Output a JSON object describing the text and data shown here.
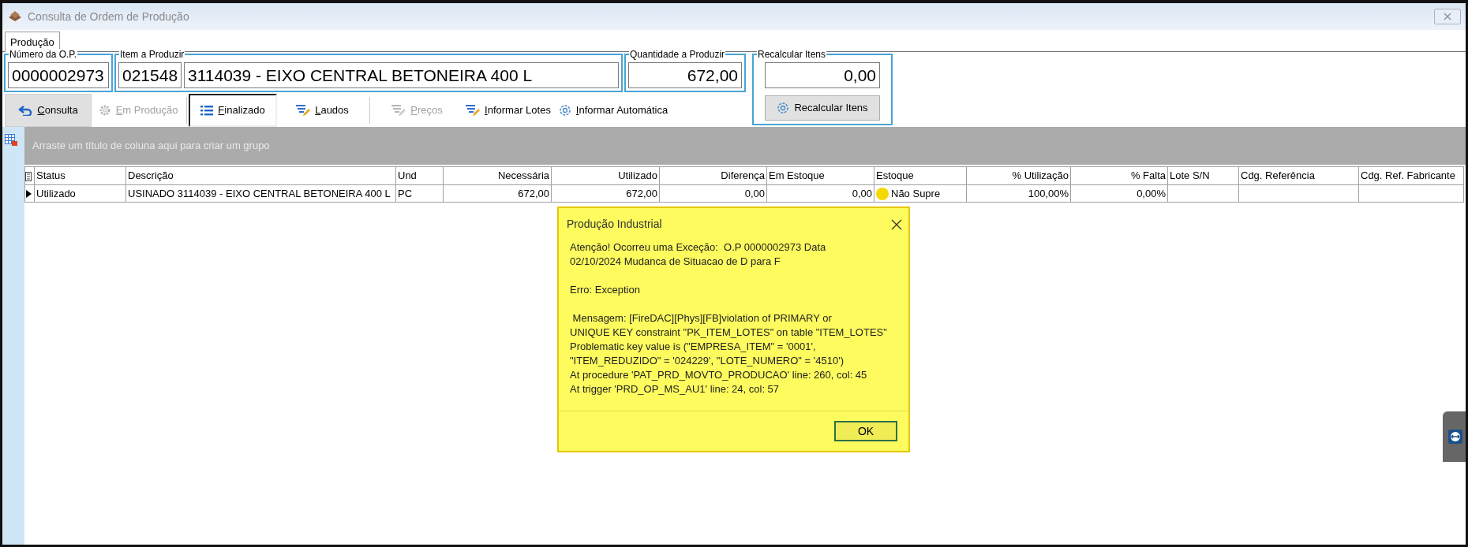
{
  "window": {
    "title": "Consulta de Ordem de Produção"
  },
  "tabs": [
    {
      "label": "Produção",
      "selected": true
    }
  ],
  "groups": [
    {
      "title": "Número da O.P.",
      "values": [
        "0000002973"
      ]
    },
    {
      "title": "Item a Produzir",
      "values": [
        "021548",
        "3114039 - EIXO CENTRAL BETONEIRA 400 L"
      ]
    },
    {
      "title": "Quantidade a Produzir",
      "values": [
        "672,00"
      ]
    },
    {
      "title": "Recalcular Itens",
      "values": [
        "0,00"
      ],
      "button": "Recalcular Itens"
    }
  ],
  "toolbar": [
    {
      "label": "Consulta",
      "disabled": false,
      "selected": false,
      "highlighted": true
    },
    {
      "label": "Em Produção",
      "disabled": true,
      "selected": false,
      "highlighted": false
    },
    {
      "label": "Finalizado",
      "disabled": false,
      "selected": true,
      "highlighted": false
    },
    {
      "label": "Laudos",
      "disabled": false,
      "selected": false,
      "highlighted": false
    },
    {
      "label": "Preços",
      "disabled": true,
      "selected": false,
      "highlighted": false
    },
    {
      "label": "Informar Lotes",
      "disabled": false,
      "selected": false,
      "highlighted": false
    },
    {
      "label": "Informar Automática",
      "disabled": false,
      "selected": false,
      "highlighted": false
    }
  ],
  "group_panel": {
    "hint": "Arraste um título de coluna aqui para criar um grupo"
  },
  "table": {
    "columns": [
      {
        "label": "Status"
      },
      {
        "label": "Descrição"
      },
      {
        "label": "Und"
      },
      {
        "label": "Necessária"
      },
      {
        "label": "Utilizado"
      },
      {
        "label": "Diferença"
      },
      {
        "label": "Em Estoque"
      },
      {
        "label": "Estoque"
      },
      {
        "label": "% Utilização"
      },
      {
        "label": "% Falta"
      },
      {
        "label": "Lote S/N"
      },
      {
        "label": "Cdg. Referência"
      },
      {
        "label": "Cdg. Ref. Fabricante"
      }
    ],
    "rows": [
      {
        "current": true,
        "color": "#f5d800",
        "cells": [
          "Utilizado",
          "USINADO 3114039 - EIXO CENTRAL BETONEIRA 400 L",
          "PC",
          "672,00",
          "672,00",
          "0,00",
          "0,00",
          "Não Supre",
          "100,00%",
          "0,00%"
        ]
      }
    ]
  },
  "dialog": {
    "title": "Produção Industrial",
    "paragraphs": [
      [
        "Atenção! Ocorreu uma Exceção:  O.P 0000002973 Data",
        "02/10/2024 Mudanca de Situacao de D para F"
      ],
      [
        "Erro: Exception"
      ],
      [
        " Mensagem: [FireDAC][Phys][FB]violation of PRIMARY or",
        "UNIQUE KEY constraint \"PK_ITEM_LOTES\" on table \"ITEM_LOTES\"",
        "Problematic key value is (\"EMPRESA_ITEM\" = '0001',",
        "\"ITEM_REDUZIDO\" = '024229', \"LOTE_NUMERO\" = '4510')",
        "At procedure 'PAT_PRD_MOVTO_PRODUCAO' line: 260, col: 45",
        "At trigger 'PRD_OP_MS_AU1' line: 24, col: 57"
      ]
    ],
    "button": "OK"
  }
}
